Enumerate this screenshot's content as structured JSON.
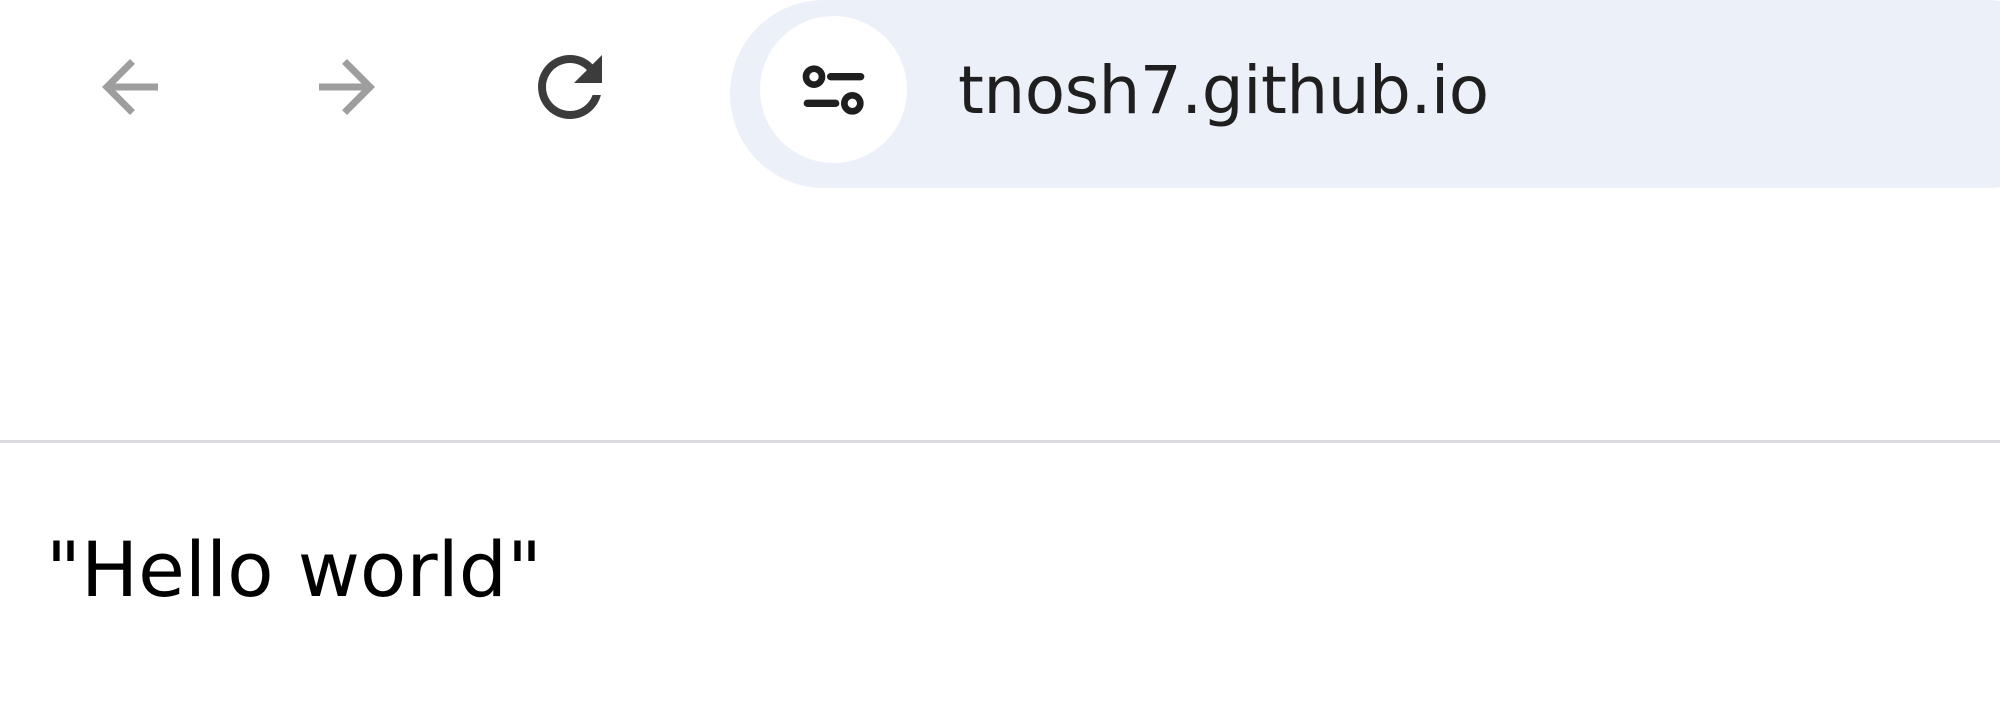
{
  "browser": {
    "toolbar": {
      "back_icon": "arrow-left-icon",
      "forward_icon": "arrow-right-icon",
      "reload_icon": "reload-icon",
      "back_enabled": false,
      "forward_enabled": false
    },
    "address_bar": {
      "site_info_icon": "tune-icon",
      "url": "tnosh7.github.io",
      "background_color": "#ecf0f9"
    }
  },
  "page": {
    "body_text": "\"Hello world\""
  },
  "colors": {
    "disabled_icon": "#9e9e9e",
    "active_icon": "#3c3c3c",
    "divider": "#dadce0",
    "text": "#000000"
  }
}
